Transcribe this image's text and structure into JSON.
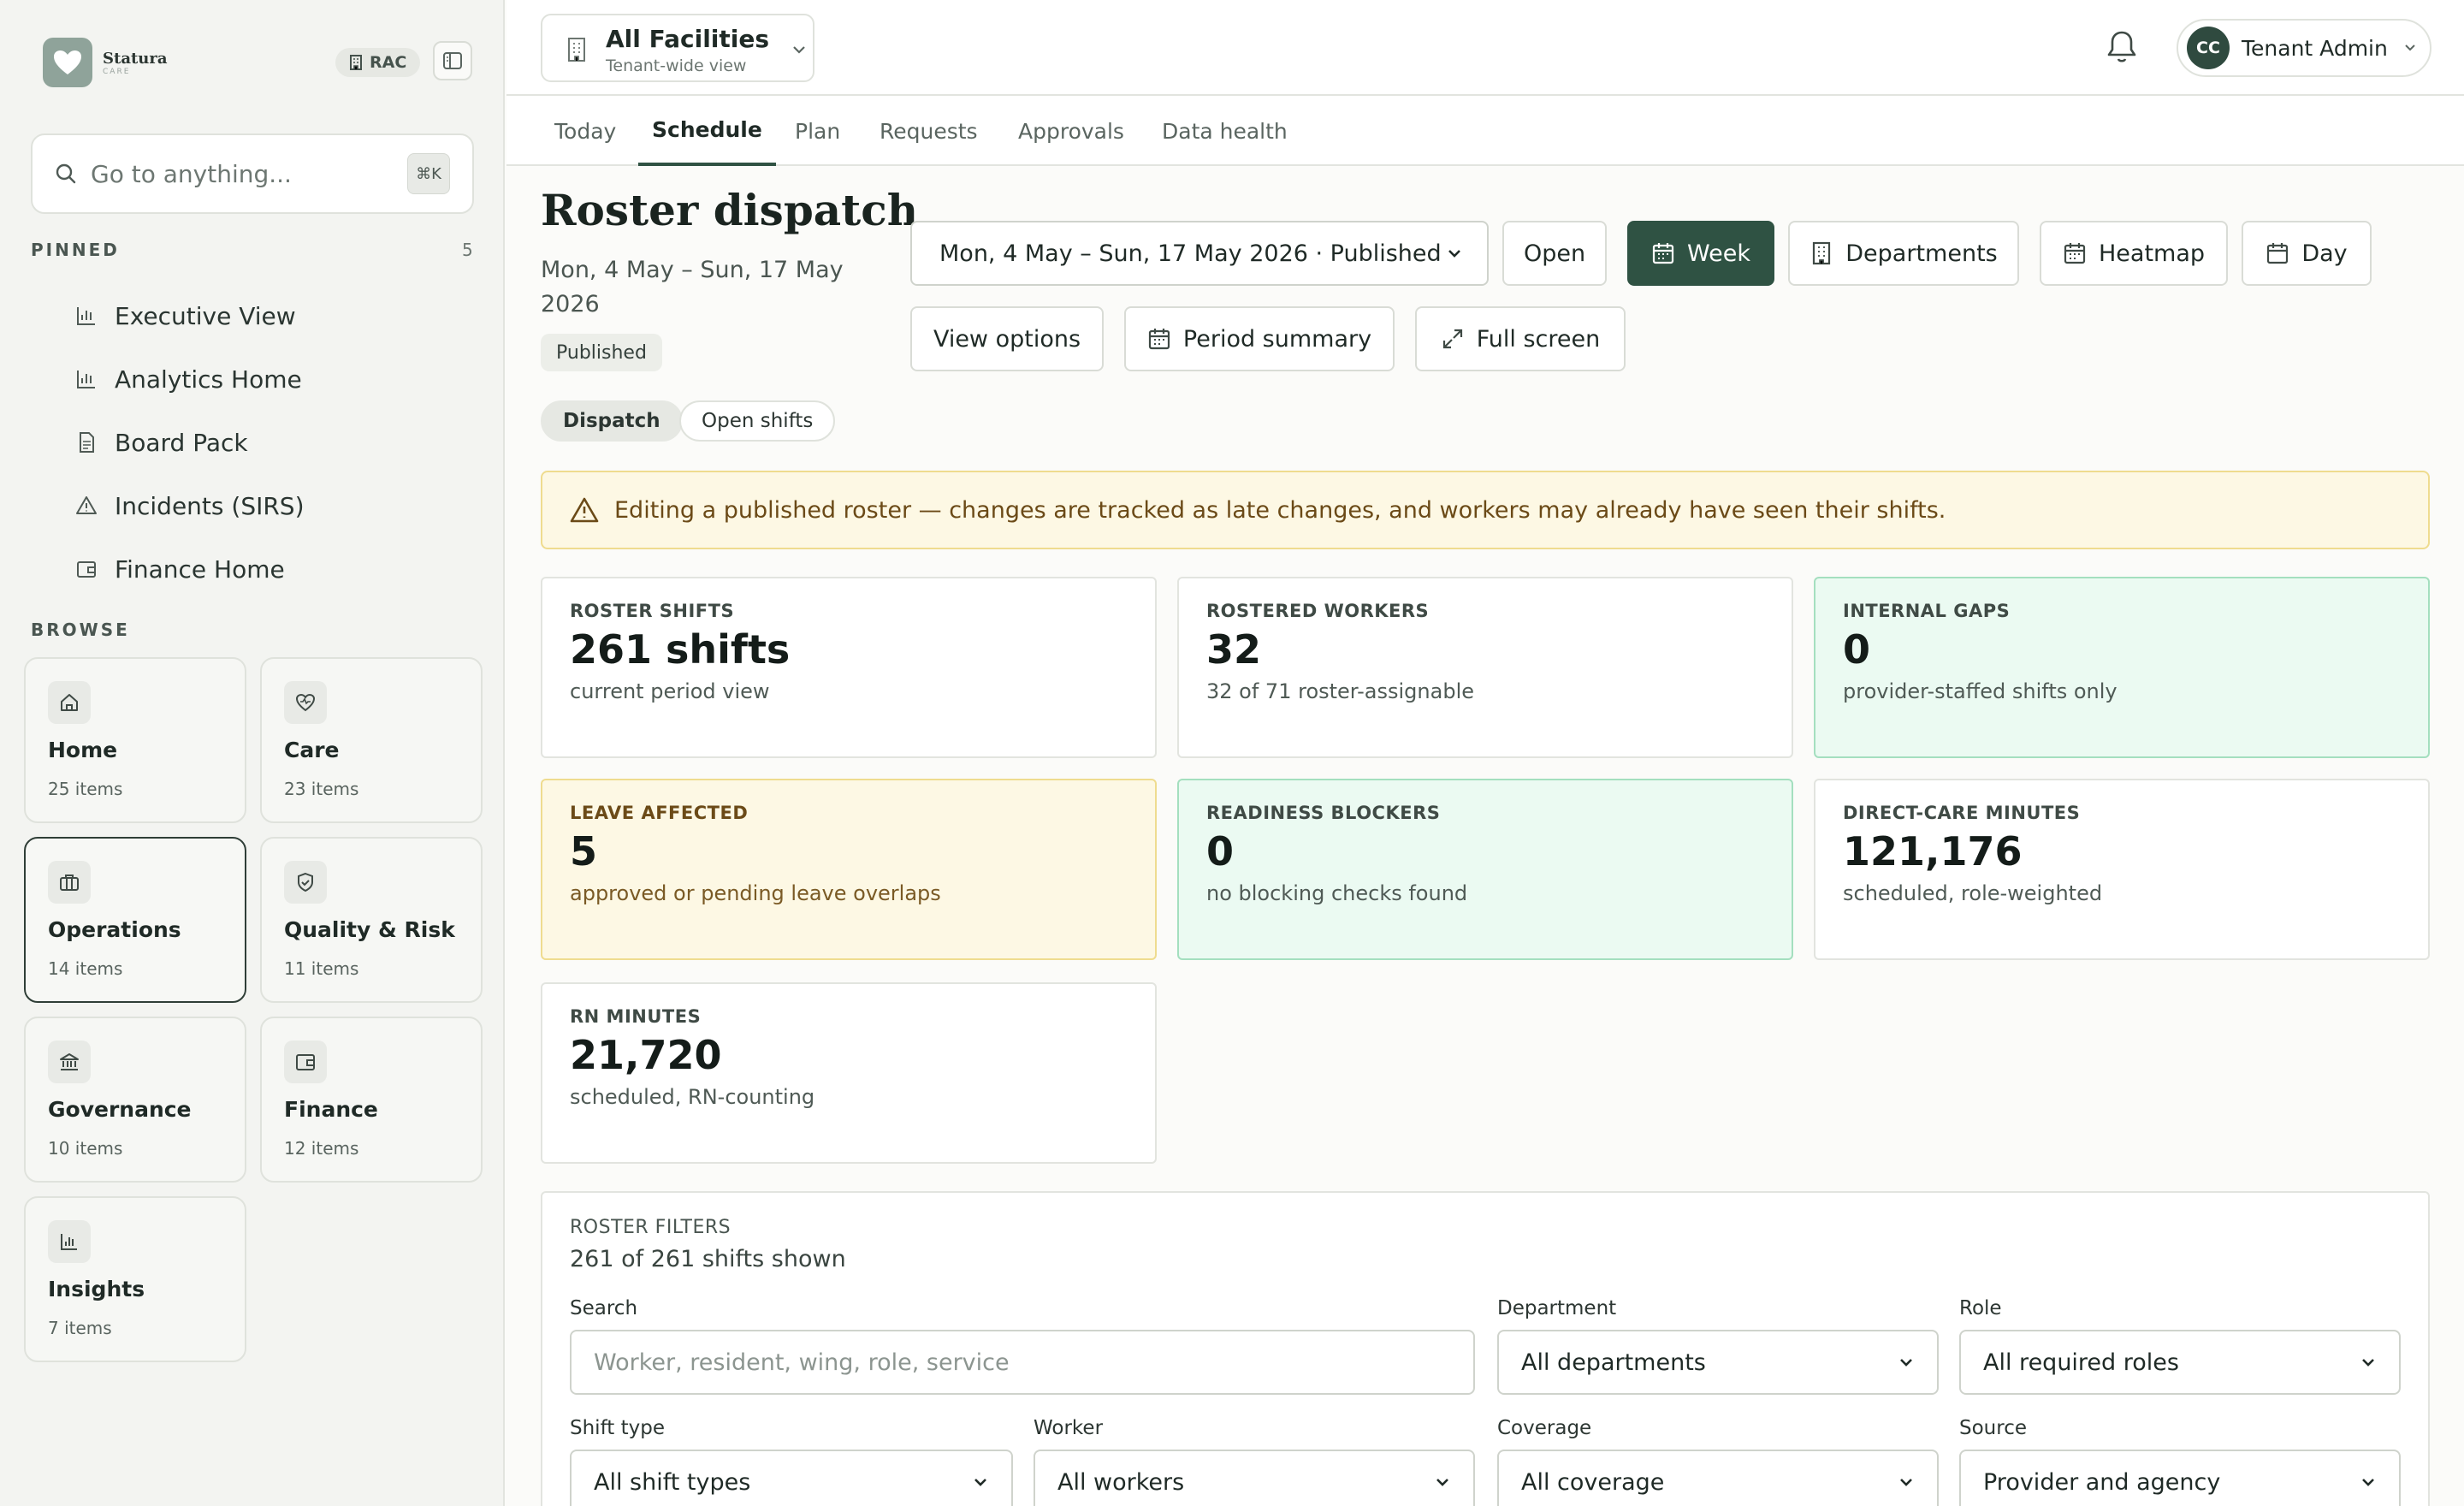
{
  "brand": {
    "name": "Statura",
    "sub": "CARE",
    "badge": "RAC"
  },
  "search": {
    "placeholder": "Go to anything...",
    "shortcut": "⌘K"
  },
  "pinned": {
    "label": "PINNED",
    "count": "5",
    "items": [
      {
        "label": "Executive View",
        "icon": "bar-chart-icon"
      },
      {
        "label": "Analytics Home",
        "icon": "bar-chart-icon"
      },
      {
        "label": "Board Pack",
        "icon": "document-icon"
      },
      {
        "label": "Incidents (SIRS)",
        "icon": "warning-icon"
      },
      {
        "label": "Finance Home",
        "icon": "wallet-icon"
      }
    ]
  },
  "browse": {
    "label": "BROWSE",
    "tiles": [
      {
        "title": "Home",
        "count": "25 items",
        "icon": "home-icon"
      },
      {
        "title": "Care",
        "count": "23 items",
        "icon": "heart-pulse-icon"
      },
      {
        "title": "Operations",
        "count": "14 items",
        "icon": "briefcase-icon",
        "active": true
      },
      {
        "title": "Quality & Risk",
        "count": "11 items",
        "icon": "shield-check-icon"
      },
      {
        "title": "Governance",
        "count": "10 items",
        "icon": "bank-icon"
      },
      {
        "title": "Finance",
        "count": "12 items",
        "icon": "wallet-icon"
      },
      {
        "title": "Insights",
        "count": "7 items",
        "icon": "bar-chart-icon"
      }
    ]
  },
  "header": {
    "facility_title": "All Facilities",
    "facility_sub": "Tenant-wide view",
    "user_initials": "CC",
    "user_name": "Tenant Admin"
  },
  "tabs": [
    "Today",
    "Schedule",
    "Plan",
    "Requests",
    "Approvals",
    "Data health"
  ],
  "active_tab": "Schedule",
  "page": {
    "title": "Roster dispatch",
    "dates": "Mon, 4 May – Sun, 17 May 2026",
    "status": "Published",
    "period_select": "Mon, 4 May – Sun, 17 May 2026 · Published",
    "buttons": {
      "open": "Open",
      "week": "Week",
      "departments": "Departments",
      "heatmap": "Heatmap",
      "day": "Day",
      "view_options": "View options",
      "period_summary": "Period summary",
      "full_screen": "Full screen"
    },
    "segments": [
      "Dispatch",
      "Open shifts"
    ],
    "alert": "Editing a published roster — changes are tracked as late changes, and workers may already have seen their shifts."
  },
  "cards": [
    {
      "label": "ROSTER SHIFTS",
      "value": "261 shifts",
      "note": "current period view",
      "tone": "neutral"
    },
    {
      "label": "ROSTERED WORKERS",
      "value": "32",
      "note": "32 of 71 roster-assignable",
      "tone": "neutral"
    },
    {
      "label": "INTERNAL GAPS",
      "value": "0",
      "note": "provider-staffed shifts only",
      "tone": "green"
    },
    {
      "label": "LEAVE AFFECTED",
      "value": "5",
      "note": "approved or pending leave overlaps",
      "tone": "yellow"
    },
    {
      "label": "READINESS BLOCKERS",
      "value": "0",
      "note": "no blocking checks found",
      "tone": "green"
    },
    {
      "label": "DIRECT-CARE MINUTES",
      "value": "121,176",
      "note": "scheduled, role-weighted",
      "tone": "neutral"
    },
    {
      "label": "RN MINUTES",
      "value": "21,720",
      "note": "scheduled, RN-counting",
      "tone": "neutral"
    }
  ],
  "filters": {
    "heading": "ROSTER FILTERS",
    "summary": "261 of 261 shifts shown",
    "search_label": "Search",
    "search_placeholder": "Worker, resident, wing, role, service",
    "department_label": "Department",
    "department_value": "All departments",
    "role_label": "Role",
    "role_value": "All required roles",
    "shift_type_label": "Shift type",
    "shift_type_value": "All shift types",
    "worker_label": "Worker",
    "worker_value": "All workers",
    "coverage_label": "Coverage",
    "coverage_value": "All coverage",
    "source_label": "Source",
    "source_value": "Provider and agency"
  },
  "colors": {
    "accent": "#2f5243",
    "green_bg": "#ebfaf2",
    "yellow_bg": "#fdf8e4"
  }
}
